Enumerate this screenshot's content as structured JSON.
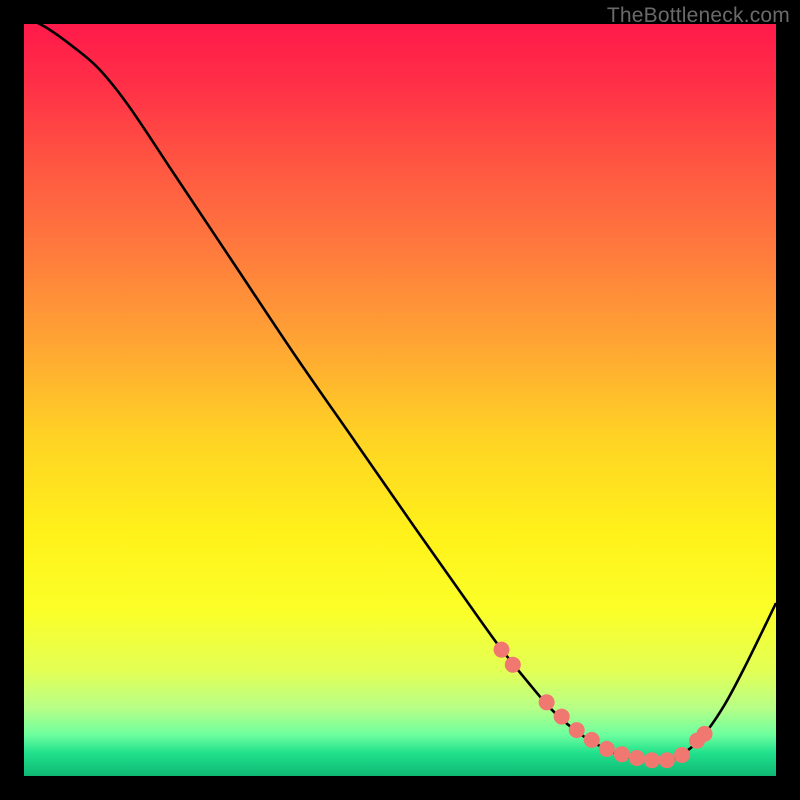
{
  "watermark": "TheBottleneck.com",
  "chart_data": {
    "type": "line",
    "title": "",
    "xlabel": "",
    "ylabel": "",
    "xlim": [
      0,
      100
    ],
    "ylim": [
      0,
      100
    ],
    "background_gradient": {
      "stops": [
        {
          "offset": 0.0,
          "color": "#ff1a4a"
        },
        {
          "offset": 0.08,
          "color": "#ff2f47"
        },
        {
          "offset": 0.18,
          "color": "#ff5442"
        },
        {
          "offset": 0.3,
          "color": "#ff7a3d"
        },
        {
          "offset": 0.42,
          "color": "#ffa334"
        },
        {
          "offset": 0.55,
          "color": "#ffd324"
        },
        {
          "offset": 0.68,
          "color": "#fff21a"
        },
        {
          "offset": 0.78,
          "color": "#fbff28"
        },
        {
          "offset": 0.86,
          "color": "#e3ff55"
        },
        {
          "offset": 0.91,
          "color": "#b6ff87"
        },
        {
          "offset": 0.945,
          "color": "#6eff9f"
        },
        {
          "offset": 0.97,
          "color": "#20e08b"
        },
        {
          "offset": 1.0,
          "color": "#0fb874"
        }
      ]
    },
    "curve": {
      "x": [
        0,
        3,
        6.5,
        10,
        14,
        20,
        28,
        36,
        44,
        52,
        58,
        63,
        67,
        70,
        73,
        76,
        79,
        82,
        84.5,
        87,
        90,
        93,
        96,
        100
      ],
      "y": [
        101,
        99.5,
        97,
        94,
        89,
        80,
        68,
        56,
        44.5,
        33,
        24.5,
        17.5,
        12.5,
        9,
        6.3,
        4.3,
        2.9,
        2.1,
        2.0,
        2.6,
        5.0,
        9.2,
        14.8,
        23.0
      ]
    },
    "markers": {
      "x": [
        63.5,
        65,
        69.5,
        71.5,
        73.5,
        75.5,
        77.5,
        79.5,
        81.5,
        83.5,
        85.5,
        87.5,
        89.5,
        90.5
      ],
      "y": [
        16.8,
        14.8,
        9.8,
        7.9,
        6.1,
        4.8,
        3.6,
        2.9,
        2.4,
        2.1,
        2.1,
        2.8,
        4.7,
        5.6
      ],
      "color": "#f07870",
      "radius": 8
    }
  }
}
